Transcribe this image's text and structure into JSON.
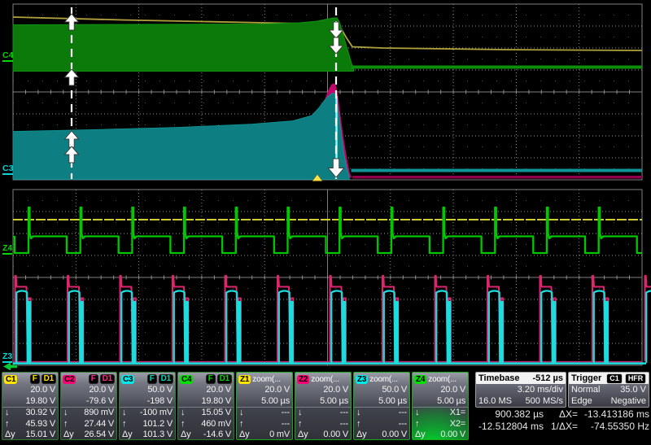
{
  "trace_labels": {
    "c4": "C4",
    "c3": "C3",
    "z4": "Z4",
    "z3": "Z3"
  },
  "symbols": {
    "min": "↓",
    "max": "↑",
    "dy": "Δy"
  },
  "palette": {
    "c1": "#ffe400",
    "c2": "#ff0074",
    "c3": "#00e8e8",
    "c4": "#00e000",
    "grid": "#7f7f7f",
    "cursor": "#ffffff",
    "trigger_marker": "#ffe24a"
  },
  "channels": [
    {
      "id": "C1",
      "color": "#ffe400",
      "badge1": "F",
      "badge2": "D1",
      "scale": "20.0 V",
      "offset": "19.80 V",
      "min": "30.92 V",
      "max": "45.93 V",
      "dy": "15.01 V"
    },
    {
      "id": "C2",
      "color": "#ff0074",
      "badge1": "F",
      "badge2": "D1",
      "scale": "20.0 V",
      "offset": "-79.6 V",
      "min": "890 mV",
      "max": "27.44 V",
      "dy": "26.54 V"
    },
    {
      "id": "C3",
      "color": "#00e8e8",
      "badge1": "F",
      "badge2": "D1",
      "scale": "50.0 V",
      "offset": "-198 V",
      "min": "-100 mV",
      "max": "101.2 V",
      "dy": "101.3 V"
    },
    {
      "id": "C4",
      "color": "#00e000",
      "badge1": "F",
      "badge2": "D1",
      "scale": "20.0 V",
      "offset": "19.80 V",
      "min": "15.05 V",
      "max": "460 mV",
      "dy": "-14.6 V"
    }
  ],
  "zoom_traces": [
    {
      "id": "Z1",
      "color": "#ffe400",
      "title": "zoom(...",
      "scale": "20.0 V",
      "time": "5.00 µs",
      "min": "---",
      "max": "---",
      "dy": "0 mV"
    },
    {
      "id": "Z2",
      "color": "#ff0074",
      "title": "zoom(...",
      "scale": "20.0 V",
      "time": "5.00 µs",
      "min": "---",
      "max": "---",
      "dy": "0.00 V"
    },
    {
      "id": "Z3",
      "color": "#00e8e8",
      "title": "zoom(...",
      "scale": "50.0 V",
      "time": "5.00 µs",
      "min": "---",
      "max": "---",
      "dy": "0.00 V"
    },
    {
      "id": "Z4",
      "color": "#00e000",
      "title": "zoom(...",
      "scale": "20.0 V",
      "time": "5.00 µs",
      "min": "X1=",
      "max": "X2=",
      "dy": "0.00 V"
    }
  ],
  "timebase": {
    "title": "Timebase",
    "delay": "-512 µs",
    "scale": "3.20 ms/div",
    "samples": "16.0 MS",
    "rate": "500 MS/s"
  },
  "trigger": {
    "title": "Trigger",
    "source_badge": "C1",
    "mode_badge": "HFR",
    "mode": "Normal",
    "level": "35.0 V",
    "coupling": "Edge",
    "slope": "Negative"
  },
  "cursors": {
    "x1": "900.382 µs",
    "x2": "-12.512804 ms",
    "dx_label": "ΔX=",
    "dx": "-13.413186 ms",
    "invdx_label": "1/ΔX=",
    "invdx": "-74.55350 Hz"
  }
}
